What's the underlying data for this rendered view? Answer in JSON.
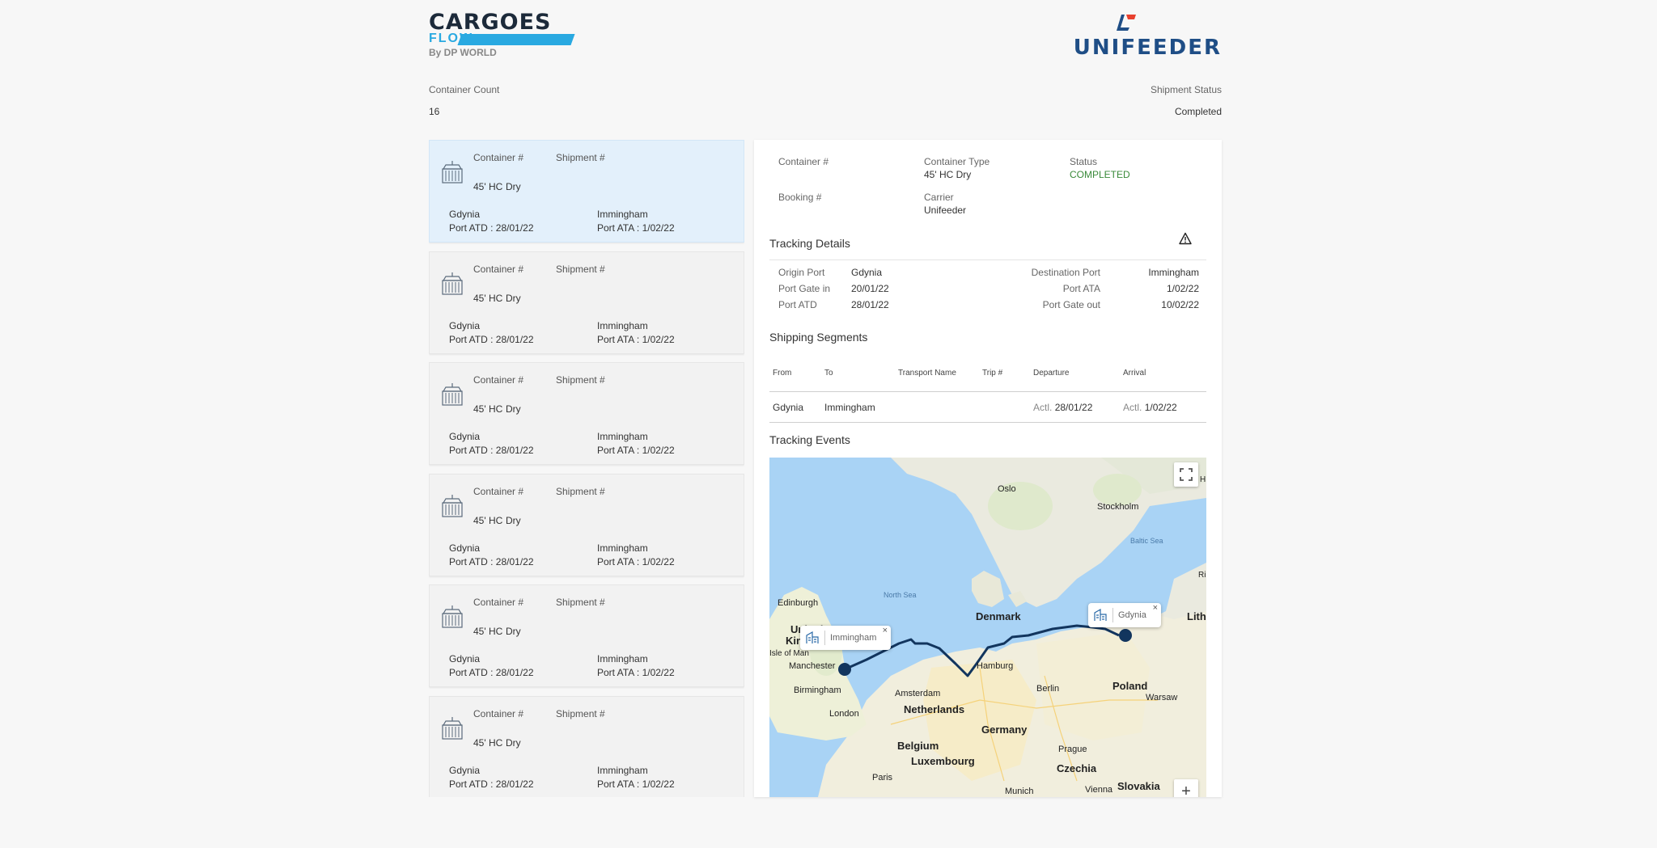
{
  "header": {
    "brand_left": {
      "line1": "CARGOES",
      "line2": "FLOW",
      "line3": "By DP WORLD"
    },
    "brand_right": {
      "name": "UNIFEEDER"
    }
  },
  "summary": {
    "container_count_label": "Container Count",
    "container_count_value": "16",
    "shipment_status_label": "Shipment Status",
    "shipment_status_value": "Completed"
  },
  "cards": [
    {
      "container_label": "Container #",
      "shipment_label": "Shipment #",
      "size": "45' HC",
      "kind": "Dry",
      "origin": "Gdynia",
      "origin_date": "Port ATD : 28/01/22",
      "dest": "Immingham",
      "dest_date": "Port ATA : 1/02/22"
    },
    {
      "container_label": "Container #",
      "shipment_label": "Shipment #",
      "size": "45' HC",
      "kind": "Dry",
      "origin": "Gdynia",
      "origin_date": "Port ATD : 28/01/22",
      "dest": "Immingham",
      "dest_date": "Port ATA : 1/02/22"
    },
    {
      "container_label": "Container #",
      "shipment_label": "Shipment #",
      "size": "45' HC",
      "kind": "Dry",
      "origin": "Gdynia",
      "origin_date": "Port ATD : 28/01/22",
      "dest": "Immingham",
      "dest_date": "Port ATA : 1/02/22"
    },
    {
      "container_label": "Container #",
      "shipment_label": "Shipment #",
      "size": "45' HC",
      "kind": "Dry",
      "origin": "Gdynia",
      "origin_date": "Port ATD : 28/01/22",
      "dest": "Immingham",
      "dest_date": "Port ATA : 1/02/22"
    },
    {
      "container_label": "Container #",
      "shipment_label": "Shipment #",
      "size": "45' HC",
      "kind": "Dry",
      "origin": "Gdynia",
      "origin_date": "Port ATD : 28/01/22",
      "dest": "Immingham",
      "dest_date": "Port ATA : 1/02/22"
    },
    {
      "container_label": "Container #",
      "shipment_label": "Shipment #",
      "size": "45' HC",
      "kind": "Dry",
      "origin": "Gdynia",
      "origin_date": "Port ATD : 28/01/22",
      "dest": "Immingham",
      "dest_date": "Port ATA : 1/02/22"
    }
  ],
  "detail": {
    "container_label": "Container #",
    "container_type_label": "Container Type",
    "container_type_value": "45' HC  Dry",
    "status_label": "Status",
    "status_value": "COMPLETED",
    "booking_label": "Booking #",
    "carrier_label": "Carrier",
    "carrier_value": "Unifeeder",
    "tracking_title": "Tracking Details",
    "origin_port_label": "Origin Port",
    "origin_port_value": "Gdynia",
    "gate_in_label": "Port Gate in",
    "gate_in_value": "20/01/22",
    "port_atd_label": "Port ATD",
    "port_atd_value": "28/01/22",
    "dest_port_label": "Destination Port",
    "dest_port_value": "Immingham",
    "port_ata_label": "Port ATA",
    "port_ata_value": "1/02/22",
    "gate_out_label": "Port Gate out",
    "gate_out_value": "10/02/22",
    "segments_title": "Shipping Segments",
    "segments_headers": [
      "From",
      "To",
      "Transport Name",
      "Trip #",
      "Departure",
      "Arrival"
    ],
    "segments_row": {
      "from": "Gdynia",
      "to": "Immingham",
      "dep_prefix": "Actl.",
      "dep": "28/01/22",
      "arr_prefix": "Actl.",
      "arr": "1/02/22"
    },
    "events_title": "Tracking Events"
  },
  "map": {
    "cities": [
      "Oslo",
      "Stockholm",
      "Edinburgh",
      "Manchester",
      "Birmingham",
      "London",
      "Amsterdam",
      "Hamburg",
      "Berlin",
      "Warsaw",
      "Prague",
      "Paris",
      "Munich",
      "Vienna"
    ],
    "countries": [
      "Denmark",
      "Netherlands",
      "Germany",
      "Belgium",
      "Luxembourg",
      "Poland",
      "Czechia",
      "Slovakia",
      "Lithu",
      "United",
      "King",
      "Isle of Man"
    ],
    "seas": [
      "North Sea",
      "Baltic Sea"
    ],
    "popup_origin": "Gdynia",
    "popup_dest": "Immingham",
    "close_glyph": "×",
    "zoom_glyph": "+",
    "edge_labels": [
      "H",
      "Ri"
    ]
  }
}
